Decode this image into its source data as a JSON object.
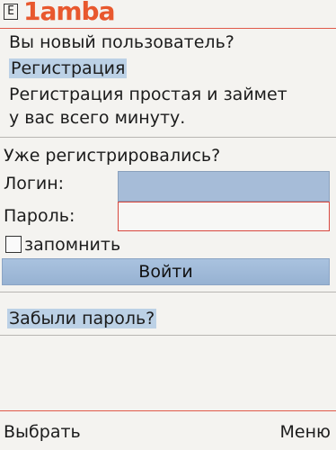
{
  "header": {
    "indicator": "E",
    "logo": "1amba"
  },
  "register": {
    "question": "Вы новый пользователь?",
    "link": "Регистрация",
    "desc_line1": "Регистрация простая и займет",
    "desc_line2": "у вас всего минуту."
  },
  "login": {
    "question": "Уже регистрировались?",
    "login_label": "Логин:",
    "login_value": "",
    "password_label": "Пароль:",
    "password_value": "",
    "remember_label": "запомнить",
    "submit": "Войти"
  },
  "forgot": {
    "link": "Забыли пароль?"
  },
  "softkeys": {
    "left": "Выбрать",
    "right": "Меню"
  }
}
